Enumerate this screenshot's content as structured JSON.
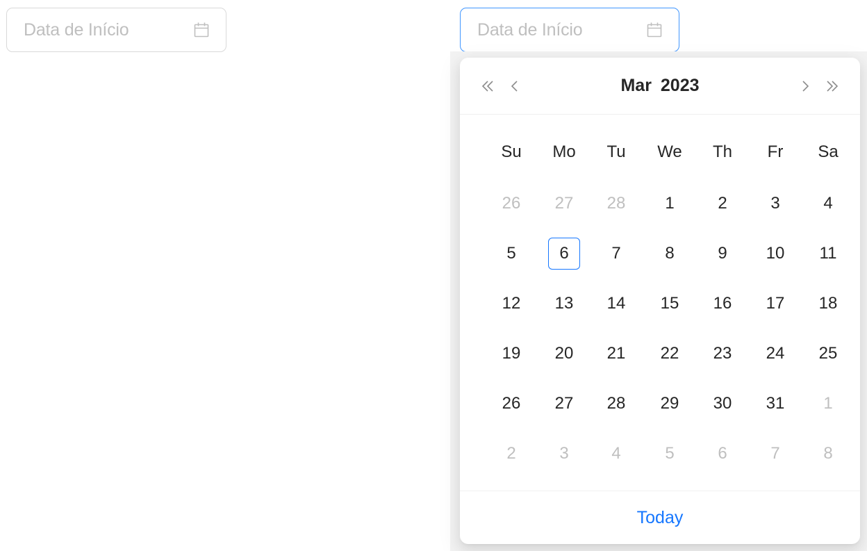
{
  "colors": {
    "accent": "#1677ff",
    "placeholder": "#bfbfbf",
    "text": "#262626",
    "muted": "#bfbfbf"
  },
  "picker_left": {
    "placeholder": "Data de Início",
    "icon": "calendar-icon"
  },
  "picker_right": {
    "placeholder": "Data de Início",
    "icon": "calendar-icon",
    "focused": true
  },
  "calendar": {
    "month": "Mar",
    "year": "2023",
    "nav": {
      "super_prev": "«",
      "prev": "‹",
      "next": "›",
      "super_next": "»"
    },
    "weekdays": [
      "Su",
      "Mo",
      "Tu",
      "We",
      "Th",
      "Fr",
      "Sa"
    ],
    "weeks": [
      [
        {
          "d": "26",
          "out": true
        },
        {
          "d": "27",
          "out": true
        },
        {
          "d": "28",
          "out": true
        },
        {
          "d": "1"
        },
        {
          "d": "2"
        },
        {
          "d": "3"
        },
        {
          "d": "4"
        }
      ],
      [
        {
          "d": "5"
        },
        {
          "d": "6",
          "today": true
        },
        {
          "d": "7"
        },
        {
          "d": "8"
        },
        {
          "d": "9"
        },
        {
          "d": "10"
        },
        {
          "d": "11"
        }
      ],
      [
        {
          "d": "12"
        },
        {
          "d": "13"
        },
        {
          "d": "14"
        },
        {
          "d": "15"
        },
        {
          "d": "16"
        },
        {
          "d": "17"
        },
        {
          "d": "18"
        }
      ],
      [
        {
          "d": "19"
        },
        {
          "d": "20"
        },
        {
          "d": "21"
        },
        {
          "d": "22"
        },
        {
          "d": "23"
        },
        {
          "d": "24"
        },
        {
          "d": "25"
        }
      ],
      [
        {
          "d": "26"
        },
        {
          "d": "27"
        },
        {
          "d": "28"
        },
        {
          "d": "29"
        },
        {
          "d": "30"
        },
        {
          "d": "31"
        },
        {
          "d": "1",
          "out": true
        }
      ],
      [
        {
          "d": "2",
          "out": true
        },
        {
          "d": "3",
          "out": true
        },
        {
          "d": "4",
          "out": true
        },
        {
          "d": "5",
          "out": true
        },
        {
          "d": "6",
          "out": true
        },
        {
          "d": "7",
          "out": true
        },
        {
          "d": "8",
          "out": true
        }
      ]
    ],
    "today_label": "Today"
  }
}
